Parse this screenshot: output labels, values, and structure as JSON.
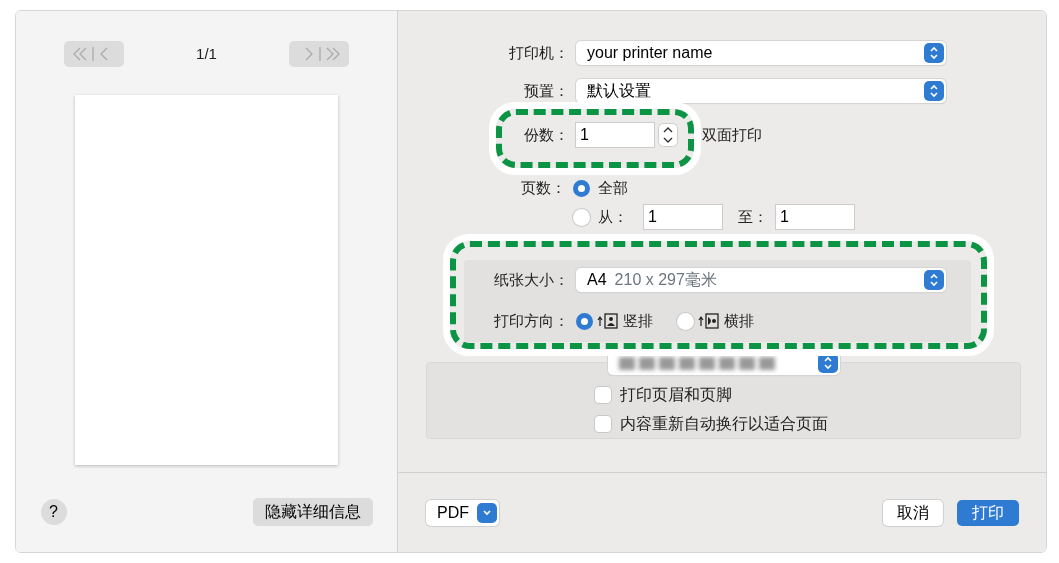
{
  "preview": {
    "page_indicator": "1/1",
    "help": "?",
    "details_button": "隐藏详细信息"
  },
  "form": {
    "printer": {
      "label": "打印机：",
      "value": "your printer name"
    },
    "preset": {
      "label": "预置：",
      "value": "默认设置"
    },
    "copies": {
      "label": "份数：",
      "value": "1",
      "duplex_label": "双面打印"
    },
    "pages": {
      "label": "页数：",
      "options": [
        {
          "kind": "all",
          "label": "全部",
          "selected": true
        },
        {
          "kind": "range",
          "label": "从：",
          "selected": false,
          "from": "1",
          "to_label": "至：",
          "to": "1"
        }
      ]
    },
    "paper_size": {
      "label": "纸张大小：",
      "size": "A4",
      "dims": "210 x 297毫米"
    },
    "orientation": {
      "label": "打印方向：",
      "options": [
        {
          "kind": "portrait",
          "label": "竖排",
          "selected": true
        },
        {
          "kind": "landscape",
          "label": "横排",
          "selected": false
        }
      ]
    },
    "options": [
      {
        "label": "打印页眉和页脚",
        "checked": false
      },
      {
        "label": "内容重新自动换行以适合页面",
        "checked": false
      }
    ]
  },
  "footer": {
    "pdf": "PDF",
    "cancel": "取消",
    "print": "打印"
  }
}
